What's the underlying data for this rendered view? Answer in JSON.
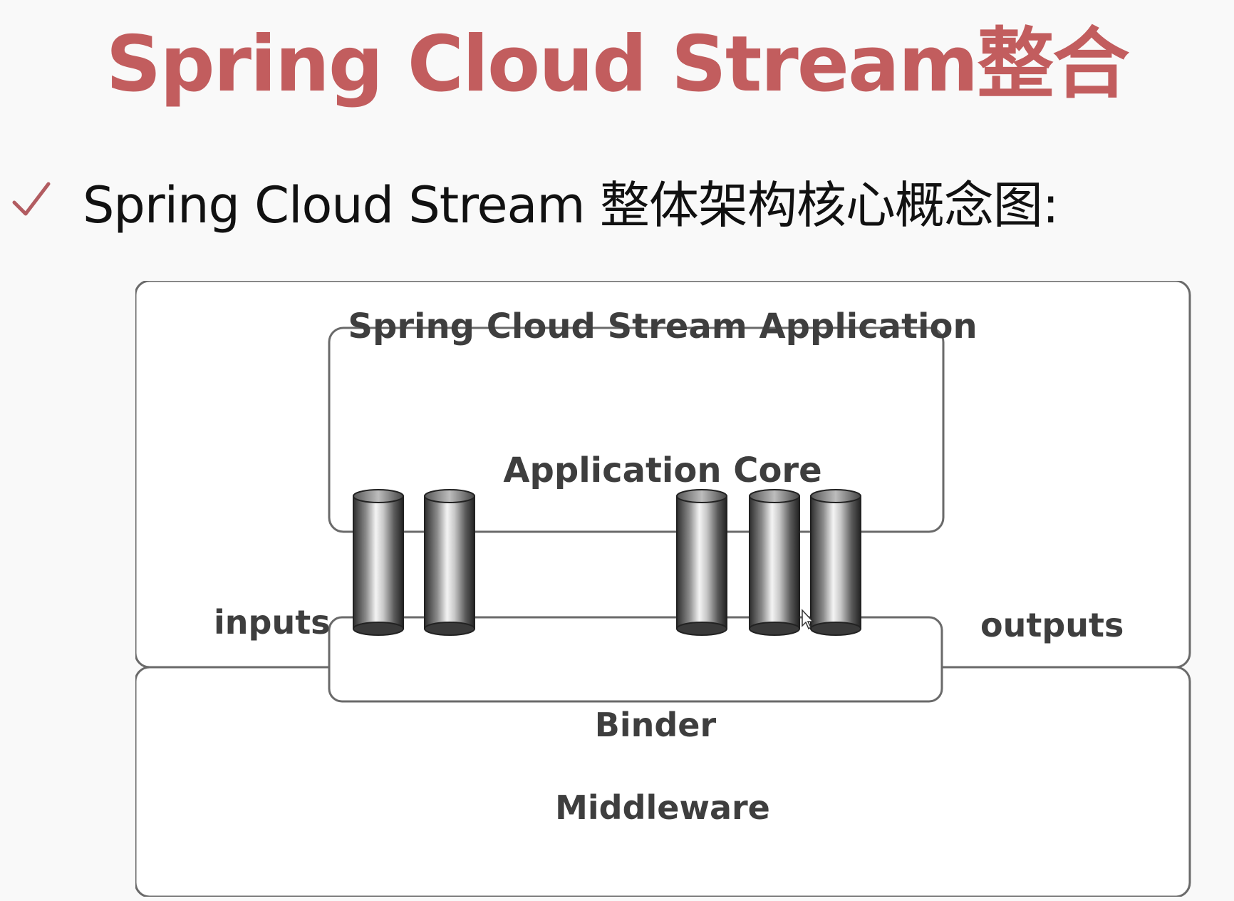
{
  "slide": {
    "title": "Spring Cloud Stream整合",
    "bullet_text": "Spring Cloud Stream 整体架构核心概念图:",
    "bullet_icon": "check-icon"
  },
  "diagram": {
    "application_label": "Spring Cloud Stream Application",
    "core_label": "Application Core",
    "inputs_label": "inputs",
    "outputs_label": "outputs",
    "binder_label": "Binder",
    "middleware_label": "Middleware",
    "input_channel_count": 2,
    "output_channel_count": 3
  },
  "colors": {
    "title": "#c25d5e",
    "check": "#b25c61",
    "text": "#111111",
    "diagram_text": "#3e3e3e",
    "box_border": "#6a6a6a"
  }
}
